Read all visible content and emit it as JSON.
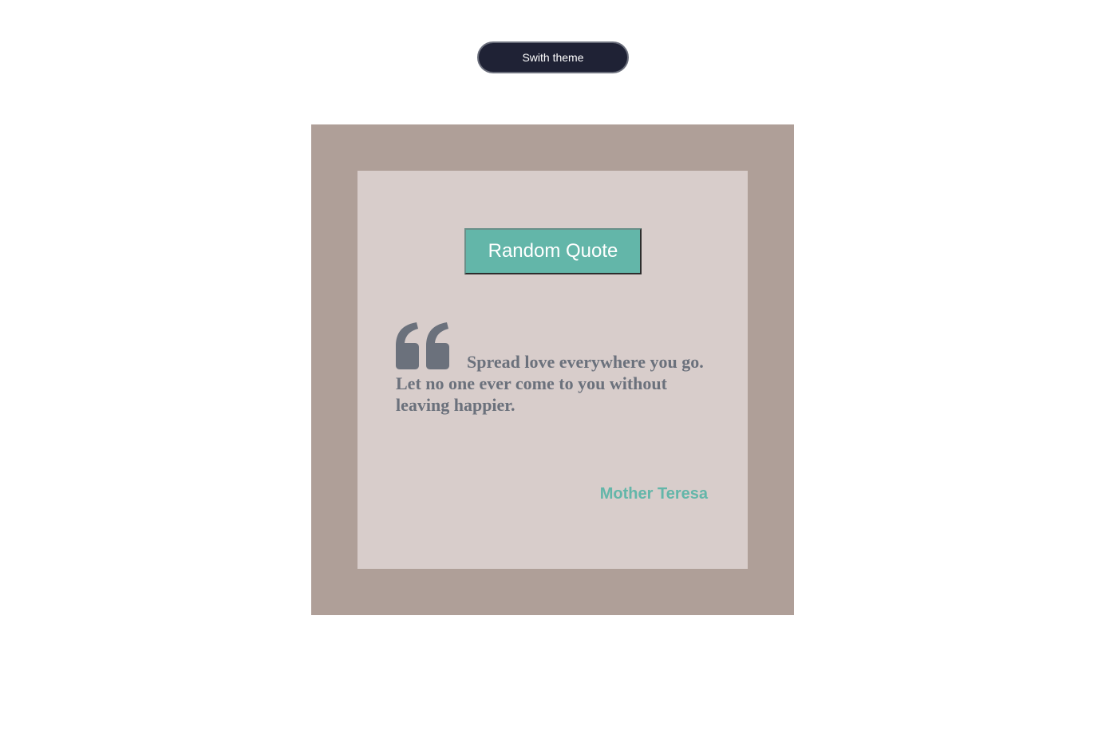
{
  "header": {
    "theme_button_label": "Swith theme"
  },
  "quote_card": {
    "random_button_label": "Random Quote",
    "quote_icon": "quote-left-icon",
    "quote_text": "Spread love everywhere you go. Let no one ever come to you without leaving happier.",
    "author": "Mother Teresa"
  },
  "colors": {
    "theme_button_bg": "#1f2235",
    "outer_frame": "#af9f98",
    "card_bg": "#d8cdcb",
    "accent": "#63b6a9",
    "quote_text": "#6b717c"
  }
}
